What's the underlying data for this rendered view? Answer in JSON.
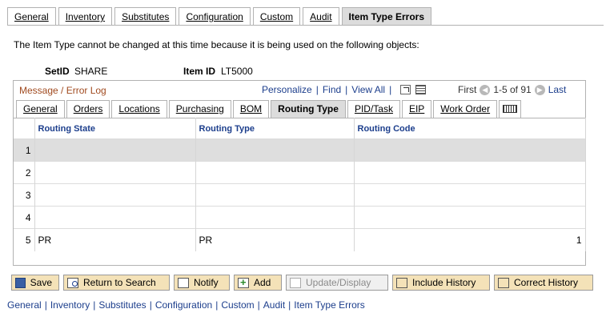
{
  "tabs": [
    {
      "label": "General",
      "active": false
    },
    {
      "label": "Inventory",
      "active": false
    },
    {
      "label": "Substitutes",
      "active": false
    },
    {
      "label": "Configuration",
      "active": false
    },
    {
      "label": "Custom",
      "active": false
    },
    {
      "label": "Audit",
      "active": false
    },
    {
      "label": "Item Type Errors",
      "active": true
    }
  ],
  "message": "The Item Type cannot be changed at this time because it is being used on the following objects:",
  "setid": {
    "label": "SetID",
    "value": "SHARE"
  },
  "item_id": {
    "label": "Item ID",
    "value": "LT5000"
  },
  "grid": {
    "title": "Message / Error Log",
    "personalize": "Personalize",
    "find": "Find",
    "view_all": "View All",
    "first": "First",
    "range": "1-5 of 91",
    "last": "Last",
    "subtabs": [
      {
        "label": "General",
        "active": false
      },
      {
        "label": "Orders",
        "active": false
      },
      {
        "label": "Locations",
        "active": false
      },
      {
        "label": "Purchasing",
        "active": false
      },
      {
        "label": "BOM",
        "active": false
      },
      {
        "label": "Routing Type",
        "active": true
      },
      {
        "label": "PID/Task",
        "active": false
      },
      {
        "label": "EIP",
        "active": false
      },
      {
        "label": "Work Order",
        "active": false
      }
    ],
    "columns": [
      "Routing State",
      "Routing Type",
      "Routing Code"
    ],
    "rows": [
      {
        "num": "1",
        "state": "",
        "type": "",
        "code": ""
      },
      {
        "num": "2",
        "state": "",
        "type": "",
        "code": ""
      },
      {
        "num": "3",
        "state": "",
        "type": "",
        "code": ""
      },
      {
        "num": "4",
        "state": "",
        "type": "",
        "code": ""
      },
      {
        "num": "5",
        "state": "PR",
        "type": "PR",
        "code": "1"
      }
    ]
  },
  "buttons": {
    "save": "Save",
    "return_to_search": "Return to Search",
    "notify": "Notify",
    "add": "Add",
    "update_display": "Update/Display",
    "include_history": "Include History",
    "correct_history": "Correct History"
  },
  "footer_links": [
    "General",
    "Inventory",
    "Substitutes",
    "Configuration",
    "Custom",
    "Audit",
    "Item Type Errors"
  ]
}
